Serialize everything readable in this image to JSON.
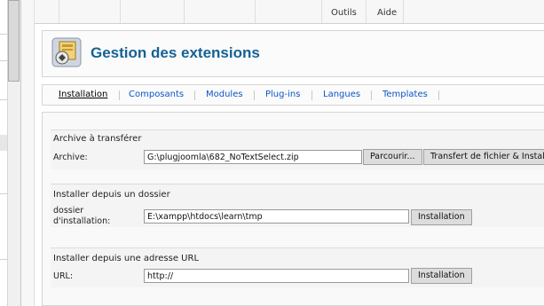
{
  "toolbar": {
    "items": [
      "Outils",
      "Aide"
    ]
  },
  "header": {
    "title": "Gestion des extensions"
  },
  "tabs": [
    {
      "label": "Installation",
      "active": true
    },
    {
      "label": "Composants"
    },
    {
      "label": "Modules"
    },
    {
      "label": "Plug-ins"
    },
    {
      "label": "Langues"
    },
    {
      "label": "Templates"
    }
  ],
  "upload": {
    "legend": "Archive à transférer",
    "label": "Archive:",
    "value": "G:\\plugjoomla\\682_NoTextSelect.zip",
    "browse_label": "Parcourir...",
    "submit_label": "Transfert de fichier & Installation"
  },
  "directory": {
    "legend": "Installer depuis un dossier",
    "label_line1": "dossier",
    "label_line2": "d'installation:",
    "value": "E:\\xampp\\htdocs\\learn\\tmp",
    "submit_label": "Installation"
  },
  "url": {
    "legend": "Installer depuis une adresse URL",
    "label": "URL:",
    "value": "http://",
    "submit_label": "Installation"
  },
  "colors": {
    "title": "#146295",
    "link": "#0b55c4"
  }
}
